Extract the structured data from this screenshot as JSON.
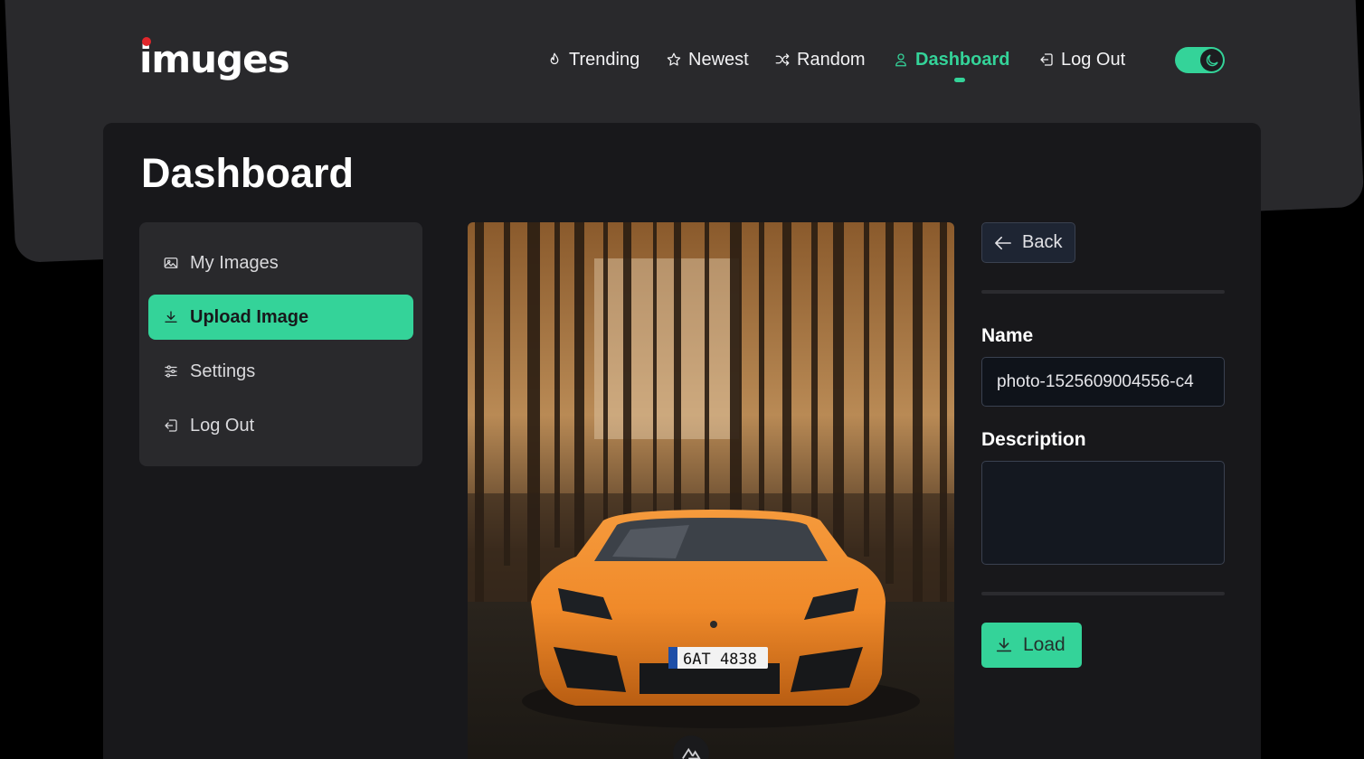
{
  "app": {
    "logo": "imuges"
  },
  "nav": {
    "items": [
      {
        "label": "Trending",
        "icon": "flame-icon"
      },
      {
        "label": "Newest",
        "icon": "star-icon"
      },
      {
        "label": "Random",
        "icon": "shuffle-icon"
      },
      {
        "label": "Dashboard",
        "icon": "user-icon",
        "active": true
      },
      {
        "label": "Log Out",
        "icon": "logout-icon"
      }
    ],
    "theme_toggle": {
      "state": "dark",
      "icon": "moon-icon"
    }
  },
  "page": {
    "title": "Dashboard"
  },
  "sidebar": {
    "items": [
      {
        "label": "My Images",
        "icon": "image-icon"
      },
      {
        "label": "Upload Image",
        "icon": "download-icon",
        "active": true
      },
      {
        "label": "Settings",
        "icon": "sliders-icon"
      },
      {
        "label": "Log Out",
        "icon": "logout-icon"
      }
    ]
  },
  "preview": {
    "subject": "orange sports car in forest",
    "plate": "6AT 4838",
    "plate_country": "CZ",
    "badge_icon": "nuxt-icon"
  },
  "form": {
    "back_label": "Back",
    "name_label": "Name",
    "name_value": "photo-1525609004556-c4",
    "description_label": "Description",
    "description_value": "",
    "load_label": "Load"
  },
  "colors": {
    "accent": "#34d399",
    "background": "#000000",
    "panel": "#18181b",
    "header": "#29292c"
  }
}
